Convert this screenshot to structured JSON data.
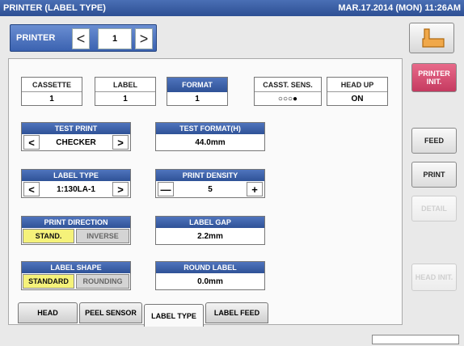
{
  "title": "PRINTER (LABEL TYPE)",
  "datetime": "MAR.17.2014 (MON) 11:26AM",
  "printer_nav": {
    "label": "PRINTER",
    "prev": "<",
    "number": "1",
    "next": ">"
  },
  "status_row": [
    {
      "header": "CASSETTE",
      "value": "1",
      "style": "white"
    },
    {
      "header": "LABEL",
      "value": "1",
      "style": "white"
    },
    {
      "header": "FORMAT",
      "value": "1",
      "style": "blue"
    },
    {
      "header": "CASST. SENS.",
      "value": "○○○●",
      "style": "white"
    },
    {
      "header": "HEAD UP",
      "value": "ON",
      "style": "white"
    }
  ],
  "test_print": {
    "header": "TEST PRINT",
    "value": "CHECKER",
    "prev": "<",
    "next": ">"
  },
  "test_format": {
    "header": "TEST FORMAT(H)",
    "value": "44.0mm"
  },
  "label_type": {
    "header": "LABEL TYPE",
    "value": "1:130LA-1",
    "prev": "<",
    "next": ">"
  },
  "print_density": {
    "header": "PRINT DENSITY",
    "value": "5",
    "minus": "—",
    "plus": "+"
  },
  "print_direction": {
    "header": "PRINT DIRECTION",
    "options": [
      "STAND.",
      "INVERSE"
    ],
    "selected": "STAND."
  },
  "label_gap": {
    "header": "LABEL GAP",
    "value": "2.2mm"
  },
  "label_shape": {
    "header": "LABEL SHAPE",
    "options": [
      "STANDARD",
      "ROUNDING"
    ],
    "selected": "STANDARD"
  },
  "round_label": {
    "header": "ROUND LABEL",
    "value": "0.0mm"
  },
  "tabs": [
    "HEAD",
    "PEEL SENSOR",
    "LABEL TYPE",
    "LABEL FEED"
  ],
  "active_tab": "LABEL TYPE",
  "side_buttons": {
    "printer_init": "PRINTER\nINIT.",
    "feed": "FEED",
    "print": "PRINT",
    "detail": "DETAIL",
    "head_init": "HEAD INIT."
  },
  "colors": {
    "title_blue": "#3a5ea5",
    "selected_yellow": "#f5f27a",
    "init_red": "#d44a6e"
  },
  "icons": {
    "back": "return-arrow-icon"
  }
}
